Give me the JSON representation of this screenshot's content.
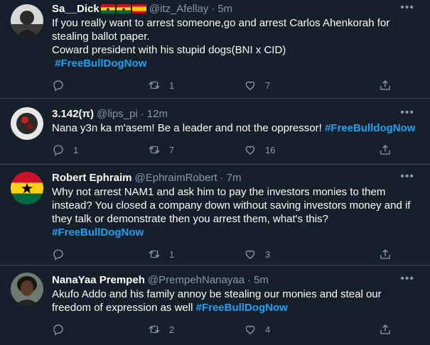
{
  "tweets": [
    {
      "name": "Sa__Dick",
      "handle": "@itz_Afellay",
      "time": "5m",
      "lines": [
        "If you really want to arrest someone,go and arrest Carlos Ahenkorah for stealing ballot paper.",
        "Coward president with his stupid dogs(BNI x CID)"
      ],
      "hashtag": "#FreeBullDogNow",
      "replies": "",
      "retweets": "1",
      "likes": "7"
    },
    {
      "name": "3.142(π)",
      "handle": "@lips_pi",
      "time": "12m",
      "text": "Nana y3n ka m'asem! Be a leader and not the oppressor!",
      "hashtag": "#FreeBulldogNow",
      "replies": "1",
      "retweets": "7",
      "likes": "16"
    },
    {
      "name": "Robert Ephraim",
      "handle": "@EphraimRobert",
      "time": "7m",
      "text": "Why not arrest NAM1 and ask him to pay the investors monies to them instead? You closed a company down without saving investors money and if they talk or demonstrate then you arrest them, what's this?",
      "hashtag": "#FreeBullDogNow",
      "replies": "",
      "retweets": "1",
      "likes": "3"
    },
    {
      "name": "NanaYaa Prempeh",
      "handle": "@PrempehNanayaa",
      "time": "5m",
      "text": "Akufo Addo and his family annoy be stealing our monies and steal our freedom of expression as well",
      "hashtag": "#FreeBullDogNow",
      "replies": "",
      "retweets": "2",
      "likes": "4"
    }
  ],
  "ui": {
    "dot": "·",
    "more": "•••"
  },
  "colors": {
    "background": "#15202b",
    "border": "#38444d",
    "muted": "#8899a6",
    "hashtag": "#1da1f2"
  }
}
